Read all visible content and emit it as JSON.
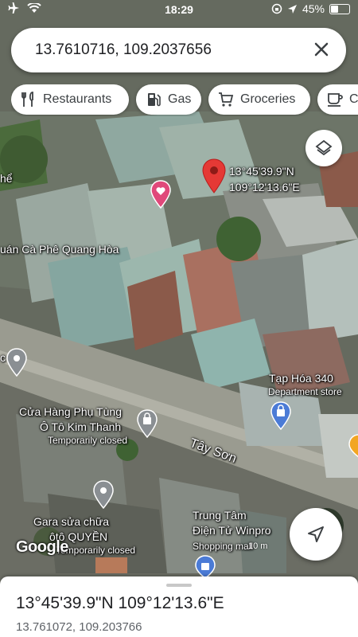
{
  "status_bar": {
    "time": "18:29",
    "battery": "45%",
    "battery_level": 0.45
  },
  "search": {
    "query": "13.7610716, 109.2037656",
    "clear_icon": "close-icon"
  },
  "chips": [
    {
      "label": "Restaurants",
      "icon": "restaurant-icon"
    },
    {
      "label": "Gas",
      "icon": "gas-station-icon"
    },
    {
      "label": "Groceries",
      "icon": "cart-icon"
    },
    {
      "label": "Co",
      "icon": "coffee-icon"
    }
  ],
  "map": {
    "dropped_pin_label": {
      "lat": "13°45'39.9\"N",
      "lng": "109°12'13.6\"E"
    },
    "places": {
      "cafe_fragment": "hể",
      "cafe_quang_hoa": "uán Cà Phê Quang Hòa",
      "taphoa": "Tạp Hóa 340",
      "taphoa_type": "Department store",
      "cuahang_line1": "Cửa Hàng Phụ Tùng",
      "cuahang_line2": "Ô Tô Kim Thanh",
      "cuahang_status": "Temporarily closed",
      "road": "Tây Sơn",
      "gara_line1": "Gara sửa chữa",
      "gara_line2": "ôtô QUYỀN",
      "gara_status": "Temporarily closed",
      "trungtam_line1": "Trung Tâm",
      "trungtam_line2": "Điện Tử Winpro",
      "trungtam_type": "Shopping mall",
      "far_left": "c"
    },
    "logo": "Google",
    "scale": "10 m",
    "colors": {
      "pin_red": "#e53935",
      "pin_pink": "#e0487a",
      "pin_blue": "#4b7bd6",
      "pin_gray": "#8a8f93"
    }
  },
  "bottom_sheet": {
    "title": "13°45'39.9\"N 109°12'13.6\"E",
    "subtitle": "13.761072, 109.203766"
  }
}
